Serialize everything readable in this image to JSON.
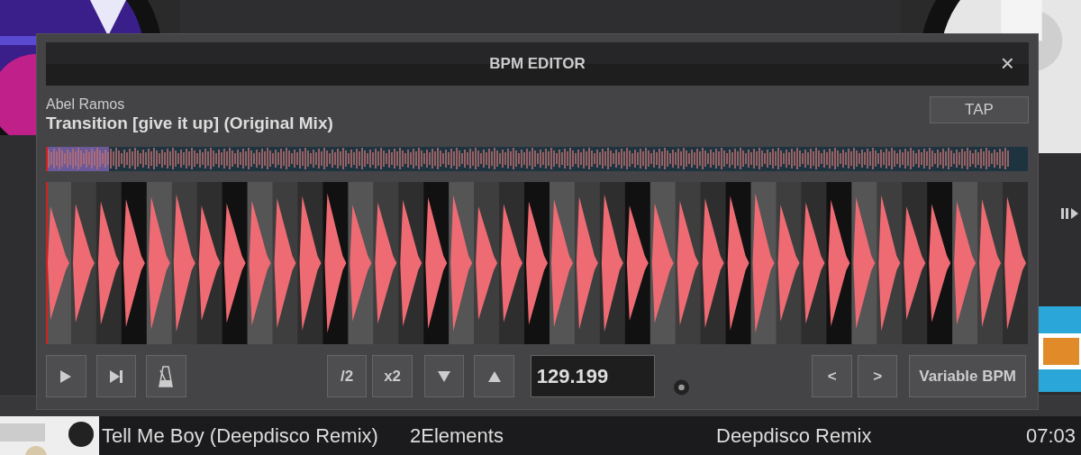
{
  "dialog": {
    "title": "BPM EDITOR",
    "close": "×",
    "artist": "Abel Ramos",
    "track": "Transition [give it up] (Original Mix)",
    "tap": "TAP",
    "multipliers": [
      "/2",
      "x2"
    ],
    "bpm": "129.199",
    "nudge": [
      "<",
      ">"
    ],
    "variable": "Variable BPM"
  },
  "library": {
    "rows": [
      {
        "title": "Tell Me Boy (Deepdisco Remix)",
        "artist": "2Elements",
        "remix": "Deepdisco Remix",
        "length": "07:03"
      }
    ]
  }
}
